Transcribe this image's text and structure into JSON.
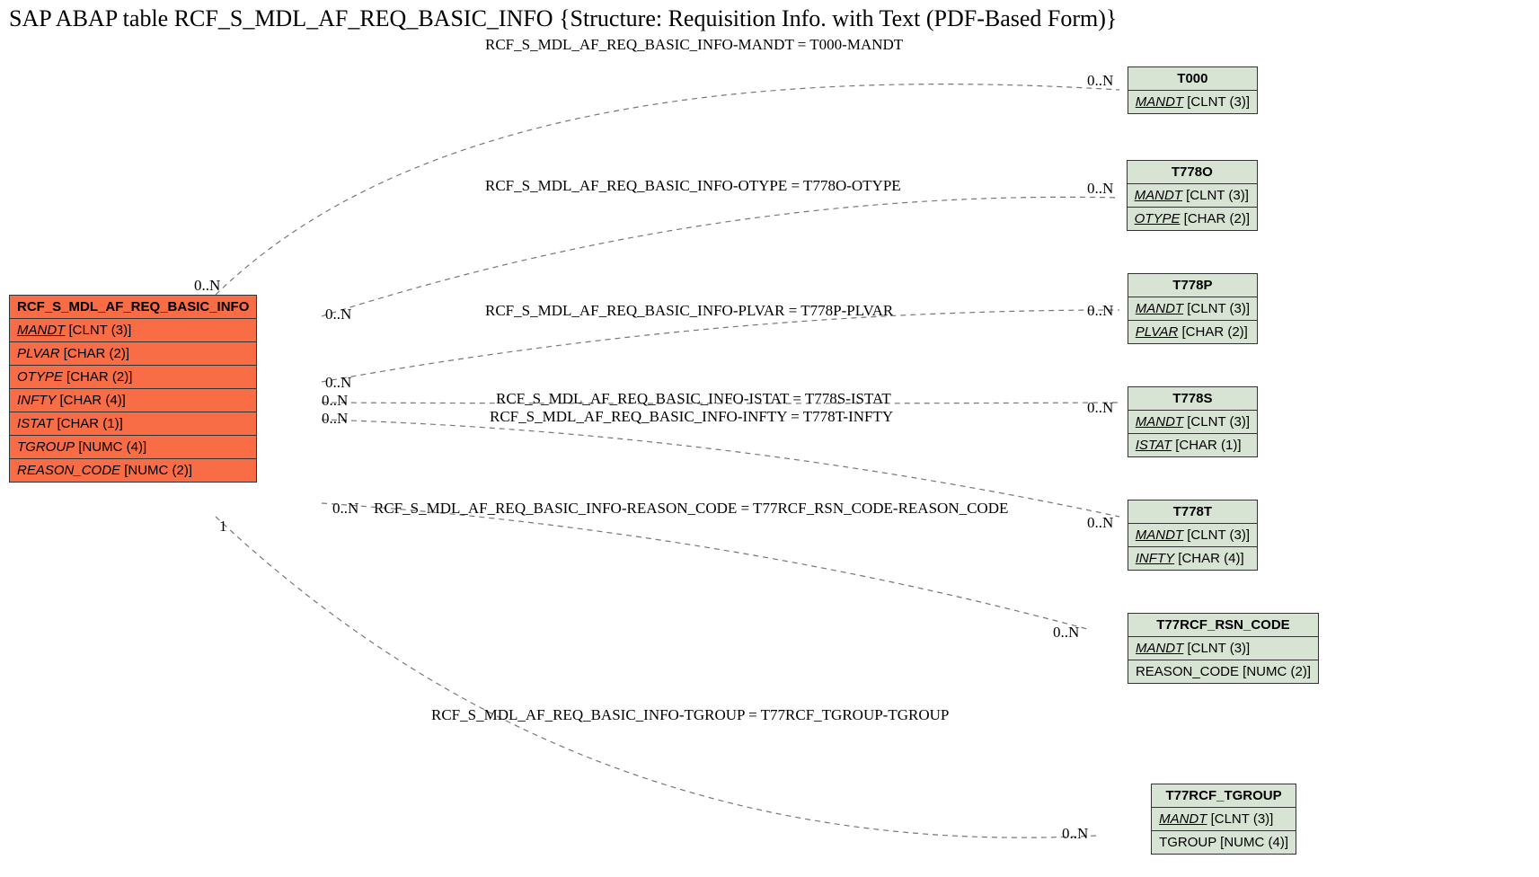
{
  "title": "SAP ABAP table RCF_S_MDL_AF_REQ_BASIC_INFO {Structure: Requisition Info. with Text (PDF-Based Form)}",
  "main": {
    "name": "RCF_S_MDL_AF_REQ_BASIC_INFO",
    "fields": [
      {
        "label": "MANDT",
        "type": "[CLNT (3)]",
        "style": "fk"
      },
      {
        "label": "PLVAR",
        "type": "[CHAR (2)]",
        "style": "it"
      },
      {
        "label": "OTYPE",
        "type": "[CHAR (2)]",
        "style": "it"
      },
      {
        "label": "INFTY",
        "type": "[CHAR (4)]",
        "style": "it"
      },
      {
        "label": "ISTAT",
        "type": "[CHAR (1)]",
        "style": "it"
      },
      {
        "label": "TGROUP",
        "type": "[NUMC (4)]",
        "style": "it"
      },
      {
        "label": "REASON_CODE",
        "type": "[NUMC (2)]",
        "style": "it"
      }
    ]
  },
  "refs": [
    {
      "name": "T000",
      "fields": [
        {
          "label": "MANDT",
          "type": "[CLNT (3)]",
          "style": "fk"
        }
      ]
    },
    {
      "name": "T778O",
      "fields": [
        {
          "label": "MANDT",
          "type": "[CLNT (3)]",
          "style": "fk"
        },
        {
          "label": "OTYPE",
          "type": "[CHAR (2)]",
          "style": "fk"
        }
      ]
    },
    {
      "name": "T778P",
      "fields": [
        {
          "label": "MANDT",
          "type": "[CLNT (3)]",
          "style": "fk"
        },
        {
          "label": "PLVAR",
          "type": "[CHAR (2)]",
          "style": "fk"
        }
      ]
    },
    {
      "name": "T778S",
      "fields": [
        {
          "label": "MANDT",
          "type": "[CLNT (3)]",
          "style": "fk"
        },
        {
          "label": "ISTAT",
          "type": "[CHAR (1)]",
          "style": "fk"
        }
      ]
    },
    {
      "name": "T778T",
      "fields": [
        {
          "label": "MANDT",
          "type": "[CLNT (3)]",
          "style": "fk"
        },
        {
          "label": "INFTY",
          "type": "[CHAR (4)]",
          "style": "fk"
        }
      ]
    },
    {
      "name": "T77RCF_RSN_CODE",
      "fields": [
        {
          "label": "MANDT",
          "type": "[CLNT (3)]",
          "style": "fk"
        },
        {
          "label": "REASON_CODE",
          "type": "[NUMC (2)]",
          "style": ""
        }
      ]
    },
    {
      "name": "T77RCF_TGROUP",
      "fields": [
        {
          "label": "MANDT",
          "type": "[CLNT (3)]",
          "style": "fk"
        },
        {
          "label": "TGROUP",
          "type": "[NUMC (4)]",
          "style": ""
        }
      ]
    }
  ],
  "relations": [
    {
      "label": "RCF_S_MDL_AF_REQ_BASIC_INFO-MANDT = T000-MANDT",
      "src_card": "0..N",
      "dst_card": "0..N"
    },
    {
      "label": "RCF_S_MDL_AF_REQ_BASIC_INFO-OTYPE = T778O-OTYPE",
      "src_card": "0..N",
      "dst_card": "0..N"
    },
    {
      "label": "RCF_S_MDL_AF_REQ_BASIC_INFO-PLVAR = T778P-PLVAR",
      "src_card": "0..N",
      "dst_card": "0..N"
    },
    {
      "label": "RCF_S_MDL_AF_REQ_BASIC_INFO-ISTAT = T778S-ISTAT",
      "src_card": "0..N",
      "dst_card": "0..N"
    },
    {
      "label": "RCF_S_MDL_AF_REQ_BASIC_INFO-INFTY = T778T-INFTY",
      "src_card": "0..N",
      "dst_card": "0..N"
    },
    {
      "label": "RCF_S_MDL_AF_REQ_BASIC_INFO-REASON_CODE = T77RCF_RSN_CODE-REASON_CODE",
      "src_card": "0..N",
      "dst_card": "0..N"
    },
    {
      "label": "RCF_S_MDL_AF_REQ_BASIC_INFO-TGROUP = T77RCF_TGROUP-TGROUP",
      "src_card": "1",
      "dst_card": "0..N"
    }
  ]
}
